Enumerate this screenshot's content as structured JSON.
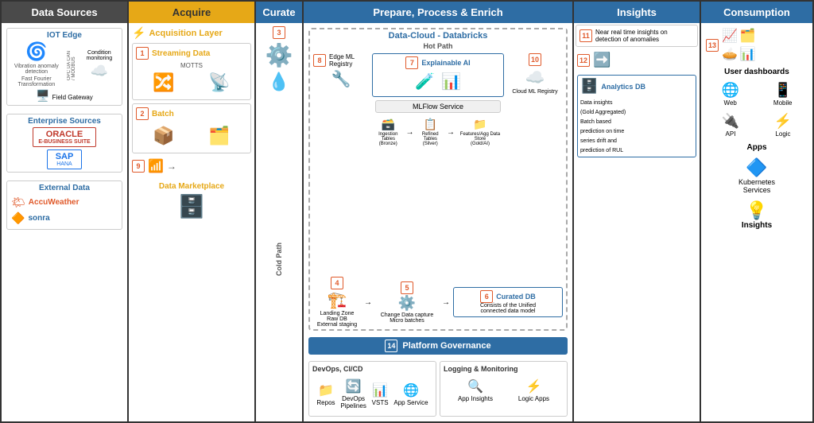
{
  "columns": {
    "datasources": {
      "label": "Data Sources"
    },
    "acquire": {
      "label": "Acquire"
    },
    "curate": {
      "label": "Curate"
    },
    "prepare": {
      "label": "Prepare, Process & Enrich"
    },
    "insights": {
      "label": "Insights"
    },
    "consumption": {
      "label": "Consumption"
    }
  },
  "datasources": {
    "iot_edge": {
      "title": "IOT Edge",
      "desc1": "Vibration anomaly detection",
      "desc2": "Fast Fourier Transformation",
      "protocols": "OPC UA CAN / MODBUS",
      "condition": "Condition monitoring",
      "gateway": "Field Gateway"
    },
    "enterprise": {
      "title": "Enterprise Sources",
      "oracle_label": "ORACLE",
      "oracle_sub": "E-BUSINESS SUITE",
      "sap_label": "SAP",
      "sap_sub": "HANA"
    },
    "external": {
      "title": "External Data",
      "accu": "AccuWeather",
      "sonra": "sonra"
    }
  },
  "acquire": {
    "layer_title": "Acquisition Layer",
    "streaming": {
      "step": "1",
      "label": "Streaming Data",
      "protocol": "MOTTS"
    },
    "batch": {
      "step": "2",
      "label": "Batch"
    },
    "marketplace": {
      "label": "Data Marketplace"
    },
    "step9": "9"
  },
  "curate": {
    "step3": "3",
    "cold_path": "Cold Path"
  },
  "prepare": {
    "databricks_title": "Data-Cloud - Databricks",
    "hot_path": "Hot Path",
    "step7": {
      "num": "7",
      "label": "Explainable AI"
    },
    "step8": {
      "num": "8",
      "label": "Edge ML Registry"
    },
    "step10": {
      "num": "10",
      "label": ""
    },
    "cloud_ml": "Cloud ML Registry",
    "mlflow": "MLFlow Service",
    "step4": {
      "num": "4",
      "label": ""
    },
    "step5": {
      "num": "5",
      "label": "Change Data capture\nMicro batches"
    },
    "step6": {
      "num": "6",
      "label": "Curated DB"
    },
    "landing_zone": "Landing Zone\nRaw DB\nExternal staging",
    "curated_desc": "Consists of the Unified\nconnected data model",
    "ingestion_bronze": "Ingestion Tables\n(Bronze)",
    "refined_silver": "Refined Tables\n(Silver)",
    "features_gold": "Features/Agg Data Store\n(Gold/AI)",
    "platform_gov": {
      "step": "14",
      "label": "Platform Governance"
    },
    "devops_title": "DevOps, CI/CD",
    "repos": "Repos",
    "devops_pipelines": "DevOps\nPipelines",
    "vsts": "VSTS",
    "app_service": "App Service",
    "logging_title": "Logging & Monitoring",
    "app_insights": "App Insights",
    "logic_apps": "Logic Apps"
  },
  "insights": {
    "step11": {
      "num": "11",
      "label": "Near real time insights on detection of anomalies"
    },
    "step12": {
      "num": "12",
      "label": ""
    },
    "analytics_db": "Analytics DB",
    "analytics_desc": "Data insights\n(Gold Aggregated)\nBatch based\nprediction on time\nseries drift and\nprediction of RUL"
  },
  "consumption": {
    "step13": "13",
    "user_dashboards": "User dashboards",
    "web": "Web",
    "mobile": "Mobile",
    "api": "API",
    "logic": "Logic",
    "apps": "Apps",
    "kubernetes": "Kubernetes\nServices",
    "insights_label": "Insights"
  }
}
